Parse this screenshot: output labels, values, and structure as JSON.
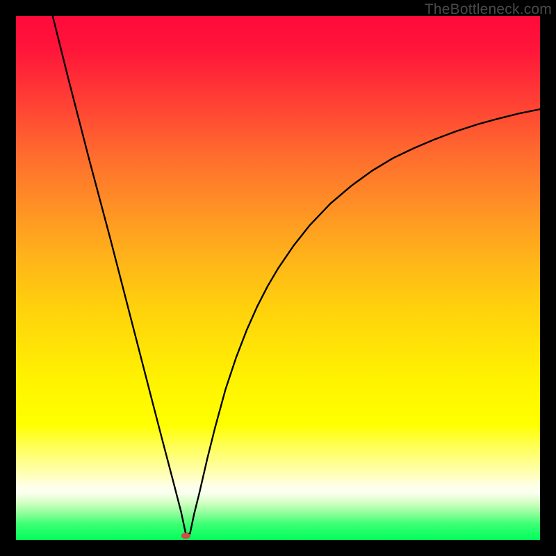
{
  "watermark": "TheBottleneck.com",
  "marker": {
    "color": "#d24a4a",
    "cx_frac": 0.324,
    "cy_frac": 0.992,
    "rx": 6.5,
    "ry": 4.5
  },
  "chart_data": {
    "type": "line",
    "title": "",
    "xlabel": "",
    "ylabel": "",
    "xlim": [
      0,
      100
    ],
    "ylim": [
      0,
      100
    ],
    "grid": false,
    "legend": false,
    "annotations": [
      "TheBottleneck.com"
    ],
    "series": [
      {
        "name": "curve",
        "x": [
          7,
          10,
          14,
          18,
          22,
          26,
          28,
          30,
          31.5,
          32.4,
          33.2,
          34,
          35,
          36.5,
          38,
          40,
          42,
          44,
          46,
          48,
          50,
          53,
          56,
          60,
          64,
          68,
          72,
          76,
          80,
          84,
          88,
          92,
          96,
          100
        ],
        "y": [
          100,
          88,
          72.5,
          57.5,
          42,
          26.5,
          18.8,
          11.2,
          5.4,
          1.2,
          1.2,
          5.0,
          9.0,
          15.5,
          21.5,
          28.8,
          34.8,
          40.0,
          44.5,
          48.4,
          51.8,
          56.2,
          60.0,
          64.2,
          67.6,
          70.5,
          72.9,
          74.8,
          76.5,
          78.0,
          79.3,
          80.4,
          81.4,
          82.2
        ]
      }
    ],
    "marker_point": {
      "x": 32.4,
      "y": 0.8
    }
  }
}
